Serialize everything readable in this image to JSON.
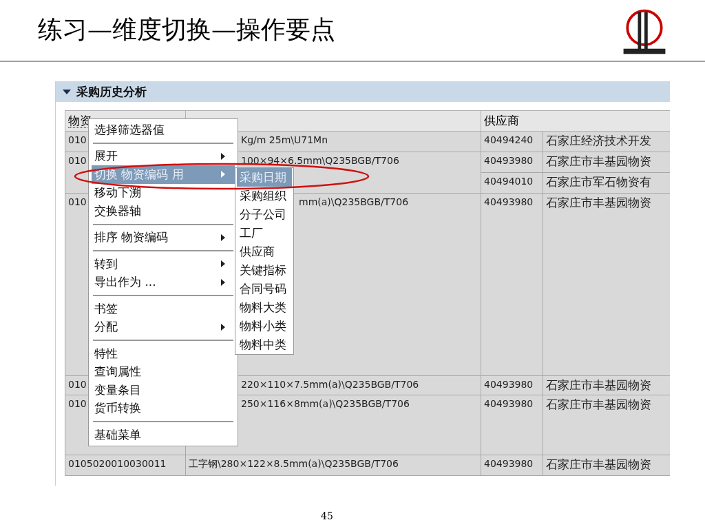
{
  "slide": {
    "title": "练习—维度切换—操作要点",
    "page_number": "45"
  },
  "panel": {
    "title": "采购历史分析",
    "expanded": true
  },
  "table": {
    "header": {
      "code": "物资",
      "supplier": "供应商"
    },
    "rows": [
      {
        "code": "010",
        "material": "Kg/m 25m\\U71Mn",
        "suppliers": [
          {
            "number": "40494240",
            "name": "石家庄经济技术开发"
          }
        ]
      },
      {
        "code": "010",
        "material": "100×94×6.5mm\\Q235BGB/T706",
        "suppliers": [
          {
            "number": "40493980",
            "name": "石家庄市丰基园物资"
          },
          {
            "number": "40494010",
            "name": "石家庄市军石物资有"
          }
        ]
      },
      {
        "code": "010",
        "material": "mm(a)\\Q235BGB/T706",
        "suppliers": [
          {
            "number": "40493980",
            "name": "石家庄市丰基园物资"
          }
        ]
      },
      {
        "code": "010",
        "material": "220×110×7.5mm(a)\\Q235BGB/T706",
        "suppliers": [
          {
            "number": "40493980",
            "name": "石家庄市丰基园物资"
          }
        ]
      },
      {
        "code": "010",
        "material": "250×116×8mm(a)\\Q235BGB/T706",
        "suppliers": [
          {
            "number": "40493980",
            "name": "石家庄市丰基园物资"
          }
        ]
      },
      {
        "code": "0105020010030011",
        "material": "工字钢\\280×122×8.5mm(a)\\Q235BGB/T706",
        "suppliers": [
          {
            "number": "40493980",
            "name": "石家庄市丰基园物资"
          }
        ]
      }
    ]
  },
  "context_menu": {
    "items": [
      {
        "kind": "item",
        "label": "选择筛选器值",
        "submenu": false,
        "selected": false
      },
      {
        "kind": "separator"
      },
      {
        "kind": "item",
        "label": "展开",
        "submenu": true,
        "selected": false
      },
      {
        "kind": "item",
        "label": "切换 物资编码 用",
        "submenu": true,
        "selected": true
      },
      {
        "kind": "item",
        "label": "移动下溯",
        "submenu": false,
        "selected": false
      },
      {
        "kind": "item",
        "label": "交换器轴",
        "submenu": false,
        "selected": false
      },
      {
        "kind": "separator"
      },
      {
        "kind": "item",
        "label": "排序 物资编码",
        "submenu": true,
        "selected": false
      },
      {
        "kind": "separator"
      },
      {
        "kind": "item",
        "label": "转到",
        "submenu": true,
        "selected": false
      },
      {
        "kind": "item",
        "label": "导出作为 ...",
        "submenu": true,
        "selected": false
      },
      {
        "kind": "separator"
      },
      {
        "kind": "item",
        "label": "书签",
        "submenu": false,
        "selected": false
      },
      {
        "kind": "item",
        "label": "分配",
        "submenu": true,
        "selected": false
      },
      {
        "kind": "separator"
      },
      {
        "kind": "item",
        "label": "特性",
        "submenu": false,
        "selected": false
      },
      {
        "kind": "item",
        "label": "查询属性",
        "submenu": false,
        "selected": false
      },
      {
        "kind": "item",
        "label": "变量条目",
        "submenu": false,
        "selected": false
      },
      {
        "kind": "item",
        "label": "货币转换",
        "submenu": false,
        "selected": false
      },
      {
        "kind": "separator"
      },
      {
        "kind": "item",
        "label": "基础菜单",
        "submenu": false,
        "selected": false
      }
    ]
  },
  "submenu": {
    "items": [
      {
        "label": "采购日期",
        "selected": true
      },
      {
        "label": "采购组织",
        "selected": false
      },
      {
        "label": "分子公司",
        "selected": false
      },
      {
        "label": "工厂",
        "selected": false
      },
      {
        "label": "供应商",
        "selected": false
      },
      {
        "label": "关键指标",
        "selected": false
      },
      {
        "label": "合同号码",
        "selected": false
      },
      {
        "label": "物料大类",
        "selected": false
      },
      {
        "label": "物料小类",
        "selected": false
      },
      {
        "label": "物料中类",
        "selected": false
      }
    ]
  }
}
